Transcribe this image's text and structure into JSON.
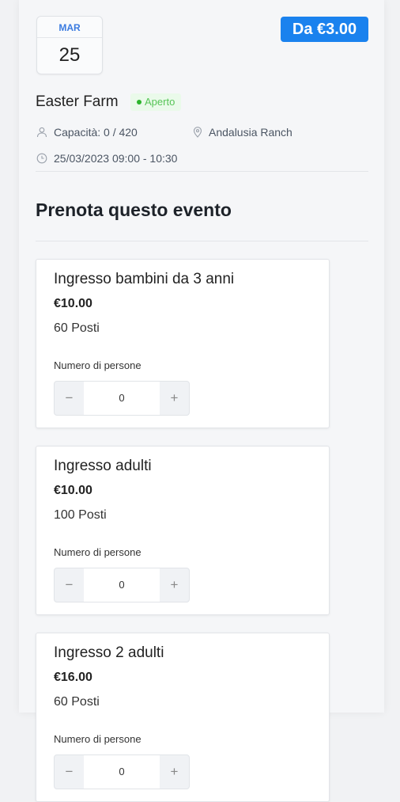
{
  "event": {
    "month": "MAR",
    "day": "25",
    "price_badge": "Da €3.00",
    "title": "Easter Farm",
    "status": "Aperto",
    "capacity": "Capacità: 0 / 420",
    "location": "Andalusia Ranch",
    "datetime": "25/03/2023 09:00 - 10:30"
  },
  "booking": {
    "section_title": "Prenota questo evento",
    "tickets": [
      {
        "name": "Ingresso bambini da 3 anni",
        "price": "€10.00",
        "seats": "60 Posti",
        "qty_label": "Numero di persone",
        "qty": "0",
        "minus": "−",
        "plus": "+"
      },
      {
        "name": "Ingresso adulti",
        "price": "€10.00",
        "seats": "100 Posti",
        "qty_label": "Numero di persone",
        "qty": "0",
        "minus": "−",
        "plus": "+"
      },
      {
        "name": "Ingresso 2 adulti",
        "price": "€16.00",
        "seats": "60 Posti",
        "qty_label": "Numero di persone",
        "qty": "0",
        "minus": "−",
        "plus": "+"
      }
    ]
  },
  "colors": {
    "accent": "#1a82ee",
    "status_green": "#2cb52c",
    "month_blue": "#3b7be0"
  }
}
